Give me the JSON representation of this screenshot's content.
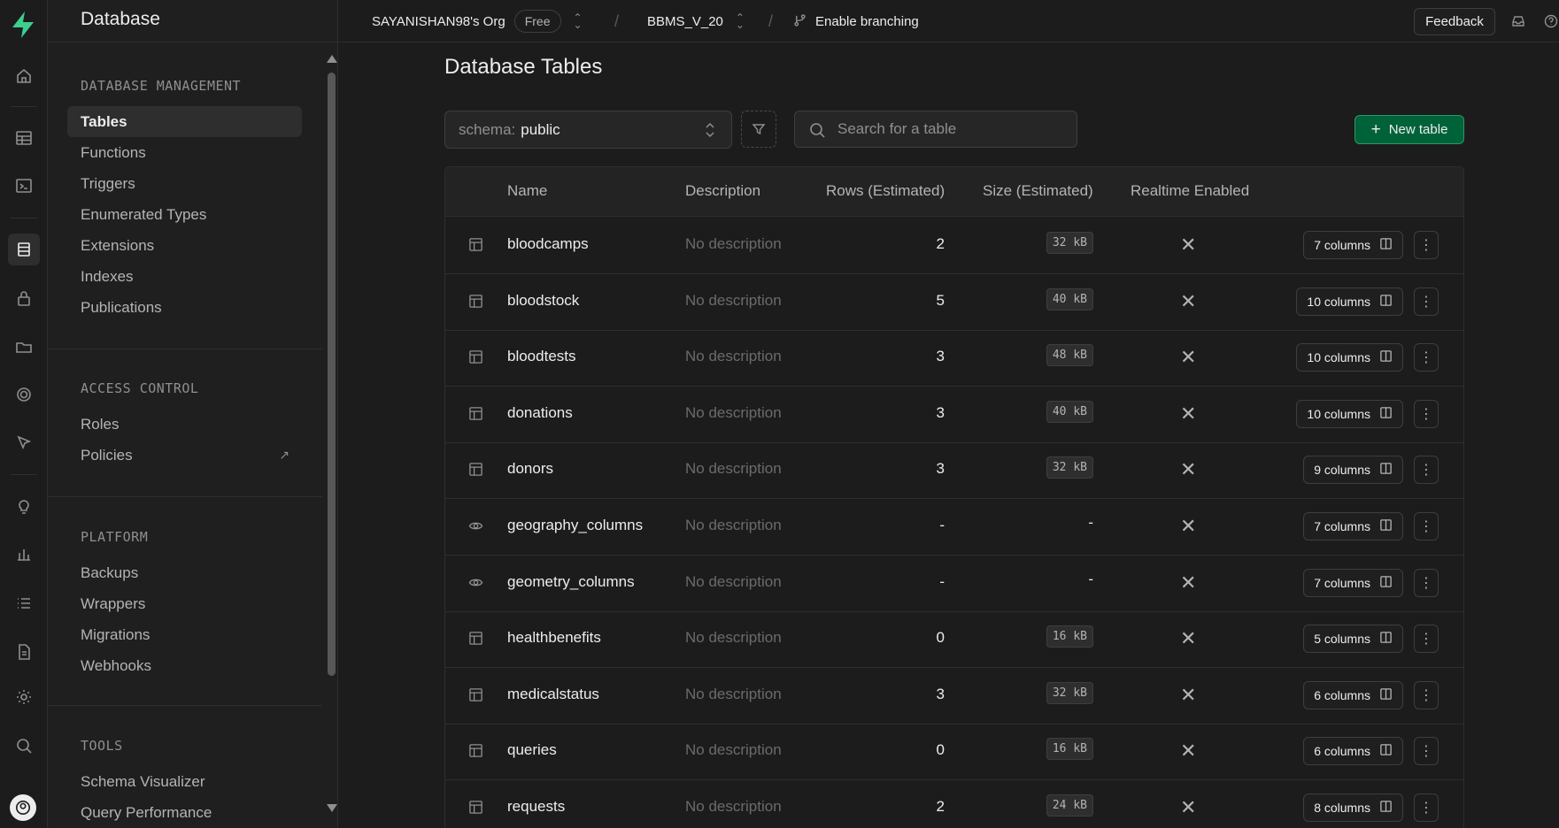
{
  "colors": {
    "brand": "#3ecf8e",
    "primary_button": "#006239",
    "background": "#1c1c1c"
  },
  "sidebar": {
    "title": "Database",
    "sections": [
      {
        "title": "DATABASE MANAGEMENT",
        "items": [
          "Tables",
          "Functions",
          "Triggers",
          "Enumerated Types",
          "Extensions",
          "Indexes",
          "Publications"
        ]
      },
      {
        "title": "ACCESS CONTROL",
        "items": [
          "Roles",
          "Policies"
        ]
      },
      {
        "title": "PLATFORM",
        "items": [
          "Backups",
          "Wrappers",
          "Migrations",
          "Webhooks"
        ]
      },
      {
        "title": "TOOLS",
        "items": [
          "Schema Visualizer",
          "Query Performance"
        ]
      }
    ],
    "active_item": "Tables"
  },
  "rail": {
    "icons": [
      "home-icon",
      "table-editor-icon",
      "sql-editor-icon",
      "database-icon",
      "auth-lock-icon",
      "storage-icon",
      "realtime-icon",
      "edge-functions-icon",
      "advisors-bulb-icon",
      "reports-icon",
      "logs-icon",
      "api-docs-icon",
      "settings-gear-icon",
      "search-icon"
    ]
  },
  "topbar": {
    "org": "SAYANISHAN98's Org",
    "plan": "Free",
    "project": "BBMS_V_20",
    "branching": "Enable branching",
    "feedback": "Feedback"
  },
  "main": {
    "title": "Database Tables",
    "schema_label": "schema:",
    "schema_value": "public",
    "search_placeholder": "Search for a table",
    "new_table": "New table",
    "columns": [
      "Name",
      "Description",
      "Rows (Estimated)",
      "Size (Estimated)",
      "Realtime Enabled"
    ],
    "rows": [
      {
        "type": "table",
        "name": "bloodcamps",
        "description": "No description",
        "rows": "2",
        "size": "32 kB",
        "columns": "7 columns"
      },
      {
        "type": "table",
        "name": "bloodstock",
        "description": "No description",
        "rows": "5",
        "size": "40 kB",
        "columns": "10 columns"
      },
      {
        "type": "table",
        "name": "bloodtests",
        "description": "No description",
        "rows": "3",
        "size": "48 kB",
        "columns": "10 columns"
      },
      {
        "type": "table",
        "name": "donations",
        "description": "No description",
        "rows": "3",
        "size": "40 kB",
        "columns": "10 columns"
      },
      {
        "type": "table",
        "name": "donors",
        "description": "No description",
        "rows": "3",
        "size": "32 kB",
        "columns": "9 columns"
      },
      {
        "type": "view",
        "name": "geography_columns",
        "description": "No description",
        "rows": "-",
        "size": "-",
        "columns": "7 columns"
      },
      {
        "type": "view",
        "name": "geometry_columns",
        "description": "No description",
        "rows": "-",
        "size": "-",
        "columns": "7 columns"
      },
      {
        "type": "table",
        "name": "healthbenefits",
        "description": "No description",
        "rows": "0",
        "size": "16 kB",
        "columns": "5 columns"
      },
      {
        "type": "table",
        "name": "medicalstatus",
        "description": "No description",
        "rows": "3",
        "size": "32 kB",
        "columns": "6 columns"
      },
      {
        "type": "table",
        "name": "queries",
        "description": "No description",
        "rows": "0",
        "size": "16 kB",
        "columns": "6 columns"
      },
      {
        "type": "table",
        "name": "requests",
        "description": "No description",
        "rows": "2",
        "size": "24 kB",
        "columns": "8 columns"
      }
    ]
  }
}
